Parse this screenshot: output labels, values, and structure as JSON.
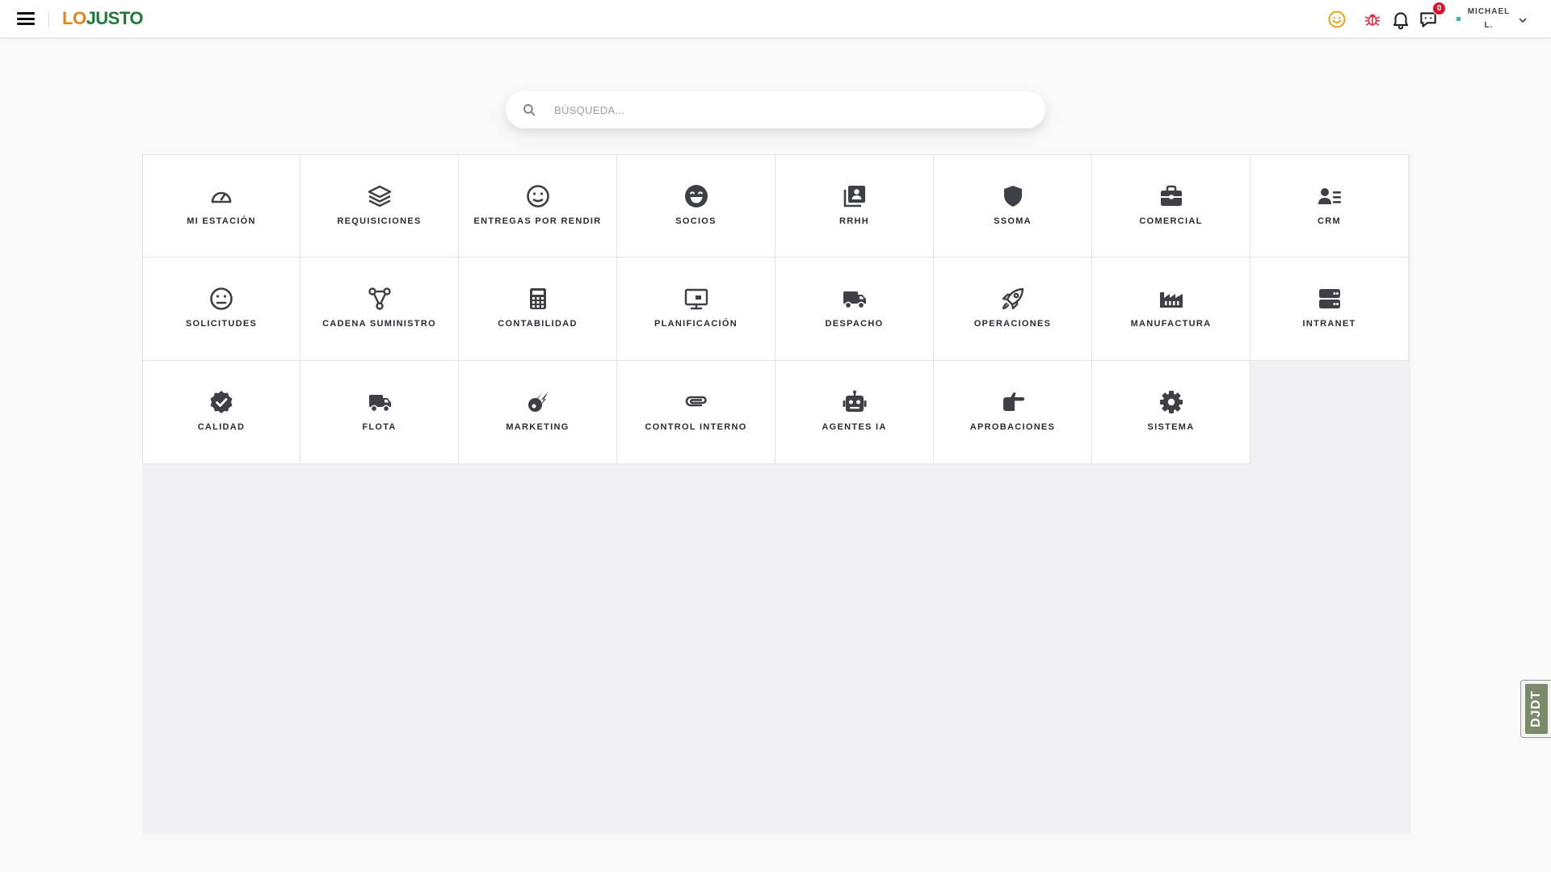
{
  "header": {
    "brand_part1": "LO",
    "brand_part2": "JUSTO",
    "notifications_badge": "0",
    "user_name_line1": "MICHAEL",
    "user_name_line2": "L.",
    "icons": [
      "menu-icon",
      "smile-icon",
      "bug-icon",
      "bell-icon",
      "chat-icon",
      "chevron-down-icon"
    ],
    "colors": {
      "brand_orange": "#e0851b",
      "brand_green": "#1f7a3a",
      "smile": "#e8a317",
      "bug": "#e0314b",
      "badge": "#d6142c"
    }
  },
  "search": {
    "placeholder": "BÚSQUEDA..."
  },
  "modules": [
    {
      "label": "MI ESTACIÓN",
      "icon": "gauge-icon"
    },
    {
      "label": "REQUISICIONES",
      "icon": "layers-icon"
    },
    {
      "label": "ENTREGAS POR RENDIR",
      "icon": "meh-face-icon"
    },
    {
      "label": "SOCIOS",
      "icon": "grin-face-icon"
    },
    {
      "label": "RRHH",
      "icon": "contact-book-icon"
    },
    {
      "label": "SSOMA",
      "icon": "shield-icon"
    },
    {
      "label": "COMERCIAL",
      "icon": "briefcase-icon"
    },
    {
      "label": "CRM",
      "icon": "user-list-icon"
    },
    {
      "label": "SOLICITUDES",
      "icon": "neutral-face-icon"
    },
    {
      "label": "CADENA SUMINISTRO",
      "icon": "nodes-icon"
    },
    {
      "label": "CONTABILIDAD",
      "icon": "calculator-icon"
    },
    {
      "label": "PLANIFICACIÓN",
      "icon": "presentation-icon"
    },
    {
      "label": "DESPACHO",
      "icon": "truck-icon"
    },
    {
      "label": "OPERACIONES",
      "icon": "rocket-icon"
    },
    {
      "label": "MANUFACTURA",
      "icon": "factory-icon"
    },
    {
      "label": "INTRANET",
      "icon": "server-icon"
    },
    {
      "label": "CALIDAD",
      "icon": "check-badge-icon"
    },
    {
      "label": "FLOTA",
      "icon": "truck-fast-icon"
    },
    {
      "label": "MARKETING",
      "icon": "meteor-icon"
    },
    {
      "label": "CONTROL INTERNO",
      "icon": "paperclip-icon"
    },
    {
      "label": "AGENTES IA",
      "icon": "robot-icon"
    },
    {
      "label": "APROBACIONES",
      "icon": "hand-point-icon"
    },
    {
      "label": "SISTEMA",
      "icon": "gear-icon"
    }
  ],
  "side_widget": {
    "text": "DJDT"
  }
}
